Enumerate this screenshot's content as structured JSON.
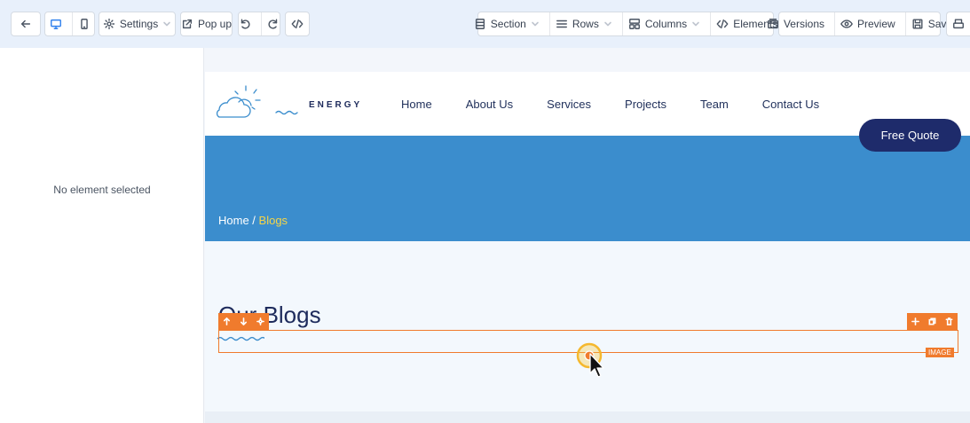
{
  "toolbar": {
    "settings_label": "Settings",
    "popup_label": "Pop up",
    "section_label": "Section",
    "rows_label": "Rows",
    "columns_label": "Columns",
    "elements_label": "Elements",
    "versions_label": "Versions",
    "preview_label": "Preview",
    "save_label": "Save"
  },
  "left_panel": {
    "empty_text": "No element selected"
  },
  "site": {
    "logo_text": "ENERGY",
    "nav": [
      "Home",
      "About Us",
      "Services",
      "Projects",
      "Team",
      "Contact Us"
    ],
    "cta_label": "Free Quote",
    "breadcrumb": {
      "home": "Home",
      "separator": " / ",
      "current": "Blogs"
    },
    "section_title": "Our Blogs",
    "selected_element_type": "IMAGE"
  },
  "colors": {
    "toolbar_bg": "#e8f0fb",
    "hero_bg": "#3b8dcd",
    "cta_bg": "#1e2b6b",
    "selection": "#f07b2d",
    "breadcrumb_current": "#f5d547"
  }
}
